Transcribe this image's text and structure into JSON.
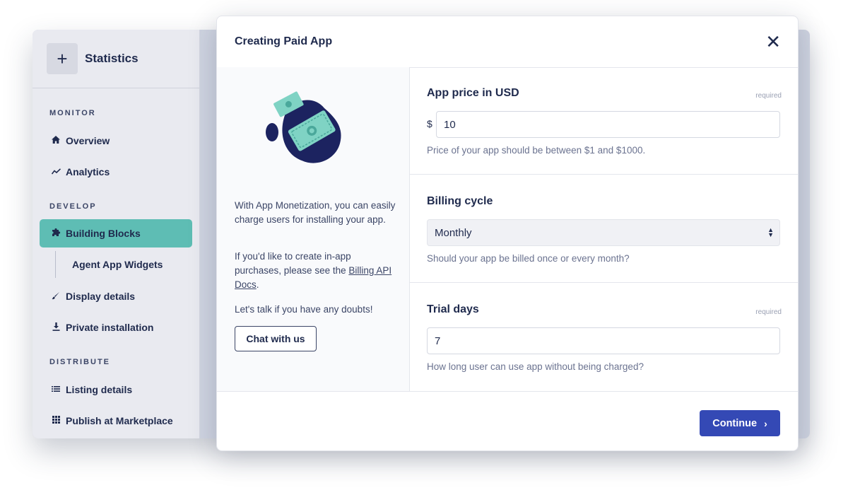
{
  "sidebar": {
    "app_name": "Statistics",
    "plus_glyph": "+",
    "sections": {
      "monitor": "MONITOR",
      "develop": "DEVELOP",
      "distribute": "DISTRIBUTE"
    },
    "items": {
      "overview": {
        "label": "Overview",
        "icon": "home-icon"
      },
      "analytics": {
        "label": "Analytics",
        "icon": "chart-line-icon"
      },
      "building_blocks": {
        "label": "Building Blocks",
        "icon": "puzzle-icon",
        "active": true
      },
      "agent_app_widgets": {
        "label": "Agent App Widgets"
      },
      "display_details": {
        "label": "Display details",
        "icon": "brush-icon"
      },
      "private_installation": {
        "label": "Private installation",
        "icon": "download-icon"
      },
      "listing_details": {
        "label": "Listing details",
        "icon": "list-icon"
      },
      "publish_marketplace": {
        "label": "Publish at Marketplace",
        "icon": "grid-icon"
      }
    },
    "active_color": "#5ebdb4"
  },
  "modal": {
    "title": "Creating Paid App",
    "close_glyph": "✕",
    "info": {
      "p1": "With App Monetization, you can easily charge users for installing your app.",
      "p2_prefix": "If you'd like to create in-app purchases, please see the ",
      "p2_link": "Billing API Docs",
      "p2_suffix": ".",
      "p3": "Let's talk if you have any doubts!"
    },
    "chat_button": "Chat with us",
    "price": {
      "label": "App price in USD",
      "required": "required",
      "currency": "$",
      "value": "10",
      "helper": "Price of your app should be between $1 and $1000."
    },
    "billing": {
      "label": "Billing cycle",
      "selected": "Monthly",
      "helper": "Should your app be billed once or every month?"
    },
    "trial": {
      "label": "Trial days",
      "required": "required",
      "value": "7",
      "helper": "How long user can use app without being charged?"
    },
    "continue_button": "Continue",
    "continue_color": "#3449b5"
  }
}
